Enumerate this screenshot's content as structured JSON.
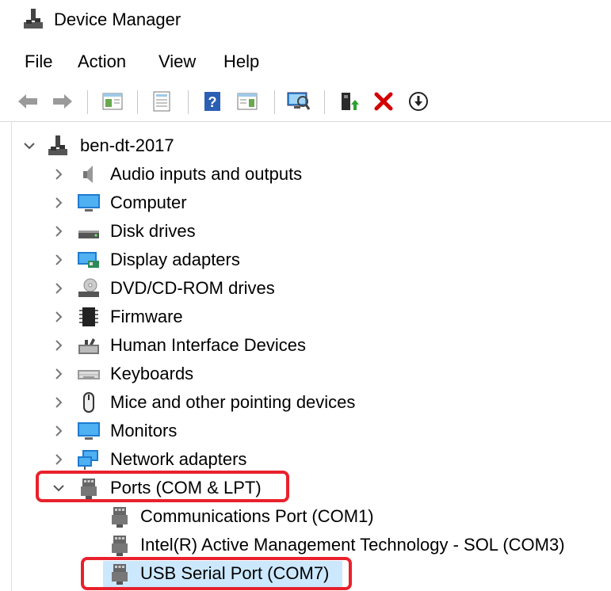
{
  "window": {
    "title": "Device Manager"
  },
  "menu": [
    "File",
    "Action",
    "View",
    "Help"
  ],
  "toolbar": {
    "icons": [
      "back-icon",
      "forward-icon",
      "show-hide-console-tree-icon",
      "properties-icon",
      "help-icon",
      "action-pane-icon",
      "scan-hardware-changes-icon",
      "update-driver-icon",
      "uninstall-icon",
      "disable-device-icon"
    ]
  },
  "tree": {
    "root": "ben-dt-2017",
    "categories": [
      "Audio inputs and outputs",
      "Computer",
      "Disk drives",
      "Display adapters",
      "DVD/CD-ROM drives",
      "Firmware",
      "Human Interface Devices",
      "Keyboards",
      "Mice and other pointing devices",
      "Monitors",
      "Network adapters",
      "Ports (COM & LPT)"
    ],
    "ports_children": [
      "Communications Port (COM1)",
      "Intel(R) Active Management Technology - SOL (COM3)",
      "USB Serial Port (COM7)"
    ],
    "selected": "USB Serial Port (COM7)"
  },
  "colors": {
    "highlight": "#e8212c",
    "selection": "#cce8ff",
    "uninstall_red": "#d40000"
  }
}
